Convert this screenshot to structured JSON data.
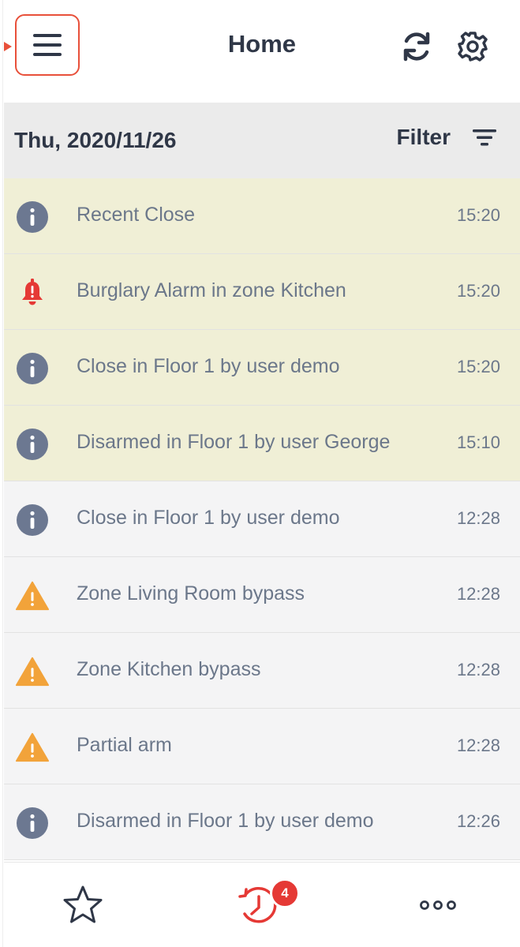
{
  "header": {
    "title": "Home",
    "menu_icon": "hamburger-menu-icon",
    "refresh_icon": "refresh-icon",
    "settings_icon": "gear-icon",
    "highlight_color": "#e8503a"
  },
  "datebar": {
    "date": "Thu, 2020/11/26",
    "filter_label": "Filter",
    "filter_icon": "filter-lines-icon"
  },
  "events": [
    {
      "text": "Recent Close",
      "time": "15:20",
      "icon": "info-icon",
      "highlighted": true
    },
    {
      "text": "Burglary Alarm in zone Kitchen",
      "time": "15:20",
      "icon": "alarm-bell-icon",
      "highlighted": true
    },
    {
      "text": "Close in Floor 1 by user demo",
      "time": "15:20",
      "icon": "info-icon",
      "highlighted": true
    },
    {
      "text": "Disarmed in Floor 1 by user George",
      "time": "15:10",
      "icon": "info-icon",
      "highlighted": true
    },
    {
      "text": "Close in Floor 1 by user demo",
      "time": "12:28",
      "icon": "info-icon",
      "highlighted": false
    },
    {
      "text": "Zone Living Room bypass",
      "time": "12:28",
      "icon": "warning-icon",
      "highlighted": false
    },
    {
      "text": "Zone Kitchen bypass",
      "time": "12:28",
      "icon": "warning-icon",
      "highlighted": false
    },
    {
      "text": "Partial arm",
      "time": "12:28",
      "icon": "warning-icon",
      "highlighted": false
    },
    {
      "text": "Disarmed in Floor 1 by user demo",
      "time": "12:26",
      "icon": "info-icon",
      "highlighted": false
    }
  ],
  "colors": {
    "info": "#6c7891",
    "alarm": "#e53935",
    "warning": "#f2a33a",
    "highlight_row": "#f0efd6",
    "normal_row": "#f4f4f5"
  },
  "bottom_nav": {
    "favorites_icon": "star-icon",
    "history_icon": "history-icon",
    "history_badge": "4",
    "more_icon": "more-dots-icon"
  }
}
